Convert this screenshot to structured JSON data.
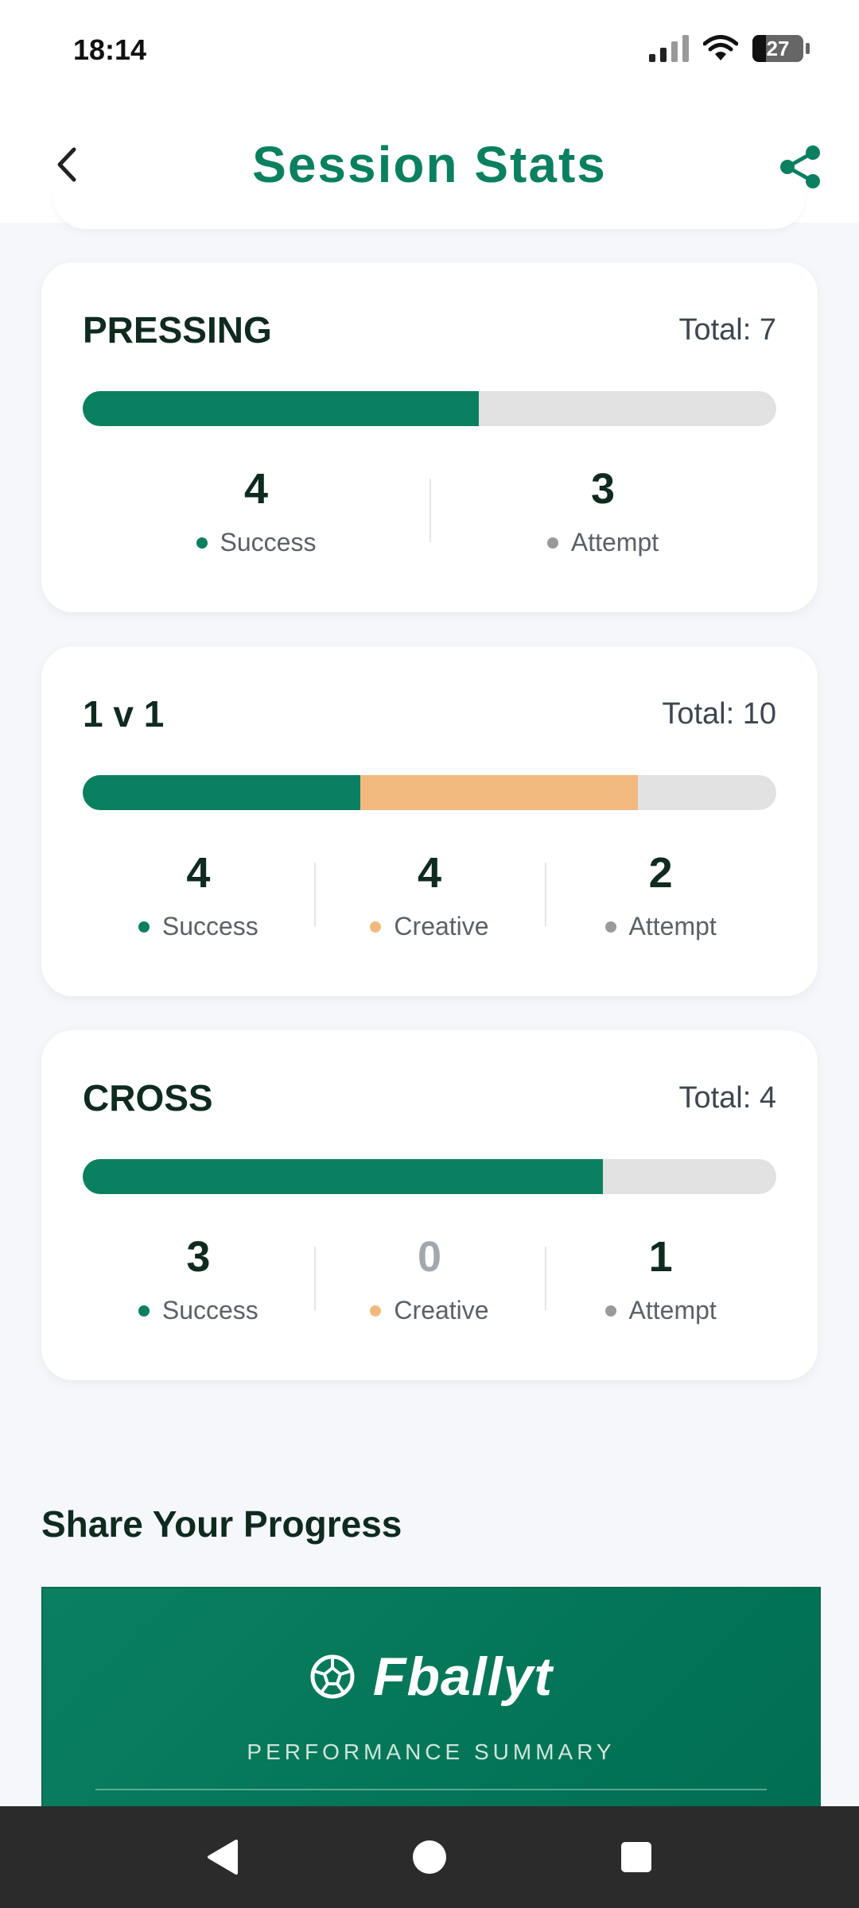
{
  "status_bar": {
    "time": "18:14",
    "battery": "27",
    "battery_level": 0.27
  },
  "header": {
    "title": "Session Stats",
    "back_icon": "chevron-left-icon",
    "share_icon": "share-icon"
  },
  "colors": {
    "accent": "#0a8060",
    "success": "#0a8060",
    "creative": "#f2b97f",
    "attempt": "#9a9a9a",
    "track": "#e2e2e2"
  },
  "cards": [
    {
      "title": "PRESSING",
      "total": "Total: 7",
      "bar": {
        "success": 4,
        "creative": 0,
        "total": 7
      },
      "stats": [
        {
          "value": "4",
          "label": "Success"
        },
        {
          "value": "3",
          "label": "Attempt"
        }
      ]
    },
    {
      "title": "1 v 1",
      "total": "Total: 10",
      "bar": {
        "success": 4,
        "creative": 4,
        "total": 10
      },
      "stats": [
        {
          "value": "4",
          "label": "Success"
        },
        {
          "value": "4",
          "label": "Creative"
        },
        {
          "value": "2",
          "label": "Attempt"
        }
      ]
    },
    {
      "title": "CROSS",
      "total": "Total: 4",
      "bar": {
        "success": 3,
        "creative": 0,
        "total": 4
      },
      "stats": [
        {
          "value": "3",
          "label": "Success"
        },
        {
          "value": "0",
          "label": "Creative"
        },
        {
          "value": "1",
          "label": "Attempt"
        }
      ]
    }
  ],
  "share_section": {
    "title": "Share Your Progress",
    "brand": "Fballyt",
    "brand_icon": "soccer-ball-icon",
    "subtitle": "PERFORMANCE SUMMARY"
  },
  "nav": {
    "back_icon": "nav-back-icon",
    "home_icon": "nav-home-icon",
    "recents_icon": "nav-recents-icon"
  }
}
